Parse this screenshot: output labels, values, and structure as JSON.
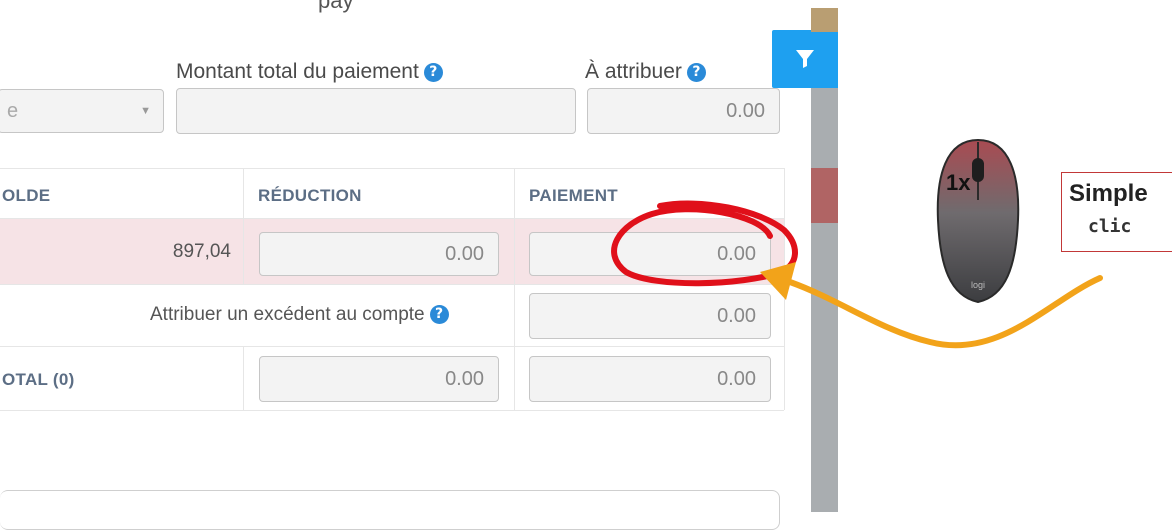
{
  "top_clipped_text": "pay",
  "payment_form": {
    "select_value": "e",
    "total_label": "Montant total du paiement",
    "total_value": "",
    "attribuer_label": "À attribuer",
    "attribuer_value": "0.00"
  },
  "table": {
    "headers": {
      "solde": "OLDE",
      "reduction": "RÉDUCTION",
      "paiement": "PAIEMENT"
    },
    "row": {
      "solde": "897,04",
      "reduction": "0.00",
      "paiement": "0.00"
    },
    "excedent_label": "Attribuer un excédent au compte",
    "excedent_value": "0.00",
    "total_label": "OTAL (0)",
    "total_reduction": "0.00",
    "total_paiement": "0.00"
  },
  "callout": {
    "mouse_badge": "1x",
    "title": "Simple",
    "subtitle": "clic"
  },
  "colors": {
    "accent": "#1ea0f0",
    "highlight_row": "#f6e3e6",
    "annotation_red": "#e0101a",
    "arrow_orange": "#f2a31a"
  },
  "icons": [
    "help-icon",
    "filter-icon",
    "chevron-down-icon",
    "mouse-icon"
  ]
}
